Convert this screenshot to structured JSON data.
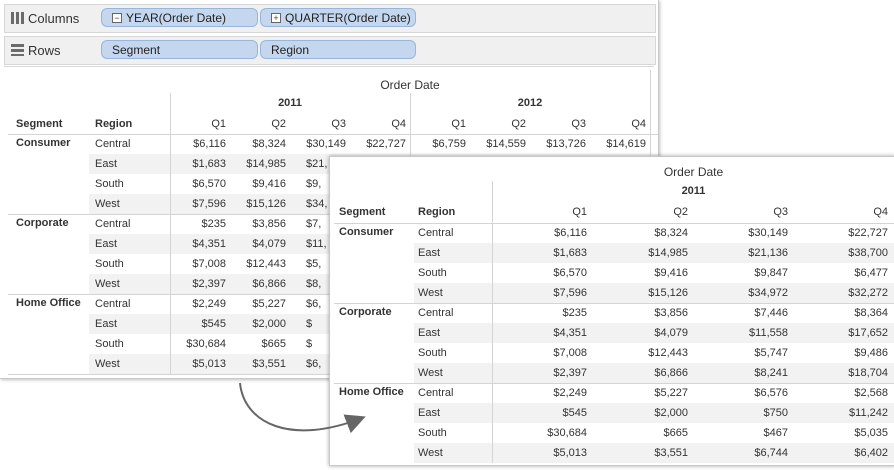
{
  "shelves": {
    "columns": {
      "label": "Columns",
      "pills": [
        {
          "text": "YEAR(Order Date)",
          "toggle": "−"
        },
        {
          "text": "QUARTER(Order Date)",
          "toggle": "+"
        }
      ]
    },
    "rows": {
      "label": "Rows",
      "pills": [
        {
          "text": "Segment"
        },
        {
          "text": "Region"
        }
      ]
    }
  },
  "main_view": {
    "column_header": "Order Date",
    "years": [
      "2011",
      "2012"
    ],
    "segment_header": "Segment",
    "region_header": "Region",
    "quarters": [
      "Q1",
      "Q2",
      "Q3",
      "Q4",
      "Q1",
      "Q2",
      "Q3",
      "Q4"
    ],
    "segments": [
      {
        "name": "Consumer",
        "rows": [
          {
            "region": "Central",
            "cells": [
              "$6,116",
              "$8,324",
              "$30,149",
              "$22,727",
              "$6,759",
              "$14,559",
              "$13,726",
              "$14,619"
            ]
          },
          {
            "region": "East",
            "cells": [
              "$1,683",
              "$14,985",
              "$21,"
            ]
          },
          {
            "region": "South",
            "cells": [
              "$6,570",
              "$9,416",
              "$9,"
            ]
          },
          {
            "region": "West",
            "cells": [
              "$7,596",
              "$15,126",
              "$34,"
            ]
          }
        ]
      },
      {
        "name": "Corporate",
        "rows": [
          {
            "region": "Central",
            "cells": [
              "$235",
              "$3,856",
              "$7,"
            ]
          },
          {
            "region": "East",
            "cells": [
              "$4,351",
              "$4,079",
              "$11,"
            ]
          },
          {
            "region": "South",
            "cells": [
              "$7,008",
              "$12,443",
              "$5,"
            ]
          },
          {
            "region": "West",
            "cells": [
              "$2,397",
              "$6,866",
              "$8,"
            ]
          }
        ]
      },
      {
        "name": "Home Office",
        "rows": [
          {
            "region": "Central",
            "cells": [
              "$2,249",
              "$5,227",
              "$6,"
            ]
          },
          {
            "region": "East",
            "cells": [
              "$545",
              "$2,000",
              "$"
            ]
          },
          {
            "region": "South",
            "cells": [
              "$30,684",
              "$665",
              "$"
            ]
          },
          {
            "region": "West",
            "cells": [
              "$5,013",
              "$3,551",
              "$6,"
            ]
          }
        ]
      }
    ]
  },
  "zoom_view": {
    "column_header": "Order Date",
    "year": "2011",
    "segment_header": "Segment",
    "region_header": "Region",
    "quarters": [
      "Q1",
      "Q2",
      "Q3",
      "Q4"
    ],
    "segments": [
      {
        "name": "Consumer",
        "rows": [
          {
            "region": "Central",
            "cells": [
              "$6,116",
              "$8,324",
              "$30,149",
              "$22,727"
            ]
          },
          {
            "region": "East",
            "cells": [
              "$1,683",
              "$14,985",
              "$21,136",
              "$38,700"
            ]
          },
          {
            "region": "South",
            "cells": [
              "$6,570",
              "$9,416",
              "$9,847",
              "$6,477"
            ]
          },
          {
            "region": "West",
            "cells": [
              "$7,596",
              "$15,126",
              "$34,972",
              "$32,272"
            ]
          }
        ]
      },
      {
        "name": "Corporate",
        "rows": [
          {
            "region": "Central",
            "cells": [
              "$235",
              "$3,856",
              "$7,446",
              "$8,364"
            ]
          },
          {
            "region": "East",
            "cells": [
              "$4,351",
              "$4,079",
              "$11,558",
              "$17,652"
            ]
          },
          {
            "region": "South",
            "cells": [
              "$7,008",
              "$12,443",
              "$5,747",
              "$9,486"
            ]
          },
          {
            "region": "West",
            "cells": [
              "$2,397",
              "$6,866",
              "$8,241",
              "$18,704"
            ]
          }
        ]
      },
      {
        "name": "Home Office",
        "rows": [
          {
            "region": "Central",
            "cells": [
              "$2,249",
              "$5,227",
              "$6,576",
              "$2,568"
            ]
          },
          {
            "region": "East",
            "cells": [
              "$545",
              "$2,000",
              "$750",
              "$11,242"
            ]
          },
          {
            "region": "South",
            "cells": [
              "$30,684",
              "$665",
              "$467",
              "$5,035"
            ]
          },
          {
            "region": "West",
            "cells": [
              "$5,013",
              "$3,551",
              "$6,744",
              "$6,402"
            ]
          }
        ]
      }
    ]
  },
  "colors": {
    "pill_fill": "#c4d7ef",
    "band": "#f2f2f2",
    "arrow": "#666666"
  }
}
